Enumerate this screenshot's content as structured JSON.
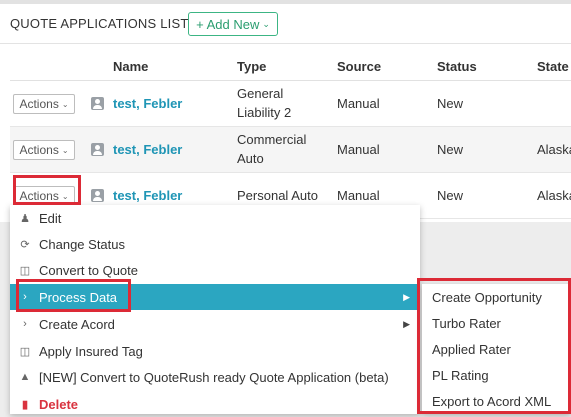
{
  "panel": {
    "title": "QUOTE APPLICATIONS LIST",
    "add_new_label": "+ Add New"
  },
  "table": {
    "headers": {
      "name": "Name",
      "type": "Type",
      "source": "Source",
      "status": "Status",
      "state": "State"
    },
    "rows": [
      {
        "actions": "Actions",
        "name": "test, Febler",
        "type_line1": "General",
        "type_line2": "Liability 2",
        "source": "Manual",
        "status": "New",
        "state": ""
      },
      {
        "actions": "Actions",
        "name": "test, Febler",
        "type_line1": "Commercial",
        "type_line2": "Auto",
        "source": "Manual",
        "status": "New",
        "state": "Alaska"
      },
      {
        "actions": "Actions",
        "name": "test, Febler",
        "type_line1": "Personal Auto",
        "type_line2": "",
        "source": "Manual",
        "status": "New",
        "state": "Alaska"
      }
    ]
  },
  "menu": {
    "items": [
      {
        "label": "Edit",
        "icon": "user-edit-icon"
      },
      {
        "label": "Change Status",
        "icon": "refresh-icon"
      },
      {
        "label": "Convert to Quote",
        "icon": "tag-icon"
      },
      {
        "label": "Process Data",
        "icon": "chevron-right-icon"
      },
      {
        "label": "Create Acord",
        "icon": "chevron-right-icon"
      },
      {
        "label": "Apply Insured Tag",
        "icon": "tag-icon"
      },
      {
        "label": "[NEW] Convert to QuoteRush ready Quote Application (beta)",
        "icon": "shapes-icon"
      },
      {
        "label": "Delete",
        "icon": "trash-icon"
      }
    ]
  },
  "submenu": {
    "items": [
      {
        "label": "Create Opportunity"
      },
      {
        "label": "Turbo Rater"
      },
      {
        "label": "Applied Rater"
      },
      {
        "label": "PL Rating"
      },
      {
        "label": "Export to Acord XML"
      }
    ]
  },
  "colors": {
    "accent": "#2ba6c1",
    "link": "#1f95b5",
    "highlight": "#dc2a36",
    "add_button": "#3cb584",
    "delete": "#d9333f"
  }
}
